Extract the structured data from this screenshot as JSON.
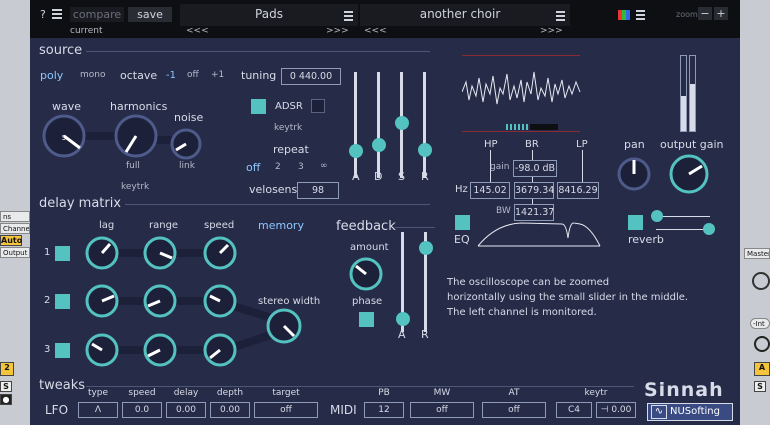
{
  "host": {
    "left_labels": [
      "ns",
      "Channe",
      "Auto",
      "Output"
    ],
    "left_track_number": "2",
    "left_solo": "S",
    "right_labels": [
      "Master"
    ],
    "right_in_label": "-Int",
    "right_track_letter": "A",
    "right_solo": "S"
  },
  "topbar": {
    "help": "?",
    "menu_icon": "hamburger-icon",
    "compare": "compare",
    "save": "save",
    "current": "current",
    "left_nav_prev": "<<<",
    "left_nav_next": ">>>",
    "preset_a": "Pads",
    "preset_b": "another choir",
    "right_nav_prev": "<<<",
    "right_nav_next": ">>>",
    "zoom_label": "zoom",
    "zoom_minus": "−",
    "zoom_plus": "+"
  },
  "source": {
    "title": "source",
    "poly": "poly",
    "mono": "mono",
    "octave_label": "octave",
    "octave_options": [
      "-1",
      "off",
      "+1"
    ],
    "tuning_label": "tuning",
    "tuning_value": "0 440.00",
    "wave_label": "wave",
    "wave_value": "5",
    "harmonics_label": "harmonics",
    "noise_label": "noise",
    "full": "full",
    "link": "link",
    "keytrk": "keytrk",
    "adsr_label": "ADSR",
    "adsr_keytrk": "keytrk",
    "repeat_label": "repeat",
    "repeat_options": [
      "off",
      "2",
      "3",
      "∞"
    ],
    "velosens_label": "velosens",
    "velosens_value": "98",
    "env_labels": [
      "A",
      "D",
      "S",
      "R"
    ]
  },
  "scope": {
    "bw_label": "BW",
    "eq_label": "EQ",
    "hp": "HP",
    "br": "BR",
    "lp": "LP",
    "gain_label": "gain",
    "gain_value": "-98.0 dB",
    "hz_label": "Hz",
    "hp_hz": "145.02",
    "br_hz": "3679.34",
    "lp_hz": "8416.29",
    "bw_value": "1421.37",
    "pan_label": "pan",
    "output_gain_label": "output gain",
    "reverb_label": "reverb",
    "notes": [
      "The oscilloscope can be zoomed",
      "horizontally using the small slider in the middle.",
      "The left channel is monitored."
    ]
  },
  "delay": {
    "title": "delay matrix",
    "col_labels": [
      "lag",
      "range",
      "speed"
    ],
    "memory": "memory",
    "row_labels": [
      "1",
      "2",
      "3"
    ],
    "stereo_width": "stereo width",
    "feedback_title": "feedback",
    "amount": "amount",
    "phase": "phase",
    "ar_labels": [
      "A",
      "R"
    ]
  },
  "tweaks": {
    "title": "tweaks",
    "lfo": "LFO",
    "lfo_headers": [
      "type",
      "speed",
      "delay",
      "depth",
      "target"
    ],
    "lfo_values": [
      "Λ",
      "0.0",
      "0.00",
      "0.00",
      "off"
    ],
    "midi": "MIDI",
    "midi_headers": [
      "PB",
      "MW",
      "AT",
      "keytr"
    ],
    "midi_values": [
      "12",
      "off",
      "off",
      "C4",
      "⊣ 0.00"
    ]
  },
  "brand": {
    "name": "Sinnah",
    "company": "NUSofting"
  }
}
